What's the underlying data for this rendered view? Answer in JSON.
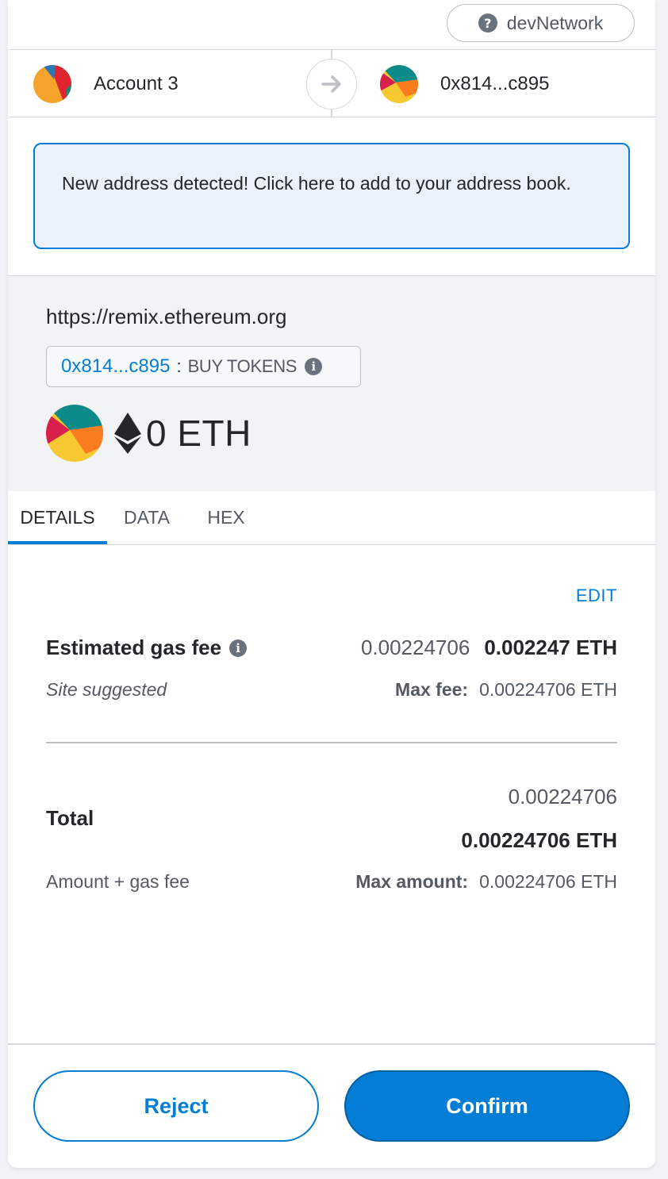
{
  "network": {
    "label": "devNetwork",
    "help_icon": "question-mark-icon"
  },
  "from_account": {
    "name": "Account 3",
    "avatar_colors": [
      "#f6a32b",
      "#e0242f",
      "#2f78b7"
    ]
  },
  "to_account": {
    "address": "0x814...c895",
    "avatar_colors": [
      "#f7c831",
      "#fa7c1e",
      "#0d8a8a",
      "#d7204c"
    ]
  },
  "banner": {
    "text": "New address detected! Click here to add to your address book."
  },
  "origin": {
    "url": "https://remix.ethereum.org",
    "method_address": "0x814...c895",
    "method_separator": ":",
    "method_name": "BUY TOKENS",
    "value": "0 ETH"
  },
  "tabs": [
    {
      "label": "DETAILS",
      "active": true
    },
    {
      "label": "DATA",
      "active": false
    },
    {
      "label": "HEX",
      "active": false
    }
  ],
  "details": {
    "edit_label": "EDIT",
    "gas_label": "Estimated gas fee",
    "gas_secondary": "0.00224706",
    "gas_primary": "0.002247 ETH",
    "site_suggested": "Site suggested",
    "max_fee_label": "Max fee:",
    "max_fee_value": "0.00224706 ETH",
    "total_label": "Total",
    "total_secondary": "0.00224706",
    "total_primary": "0.00224706 ETH",
    "amount_gas_label": "Amount + gas fee",
    "max_amount_label": "Max amount:",
    "max_amount_value": "0.00224706 ETH"
  },
  "buttons": {
    "reject": "Reject",
    "confirm": "Confirm"
  },
  "colors": {
    "primary": "#037dd6",
    "text": "#24272a",
    "muted": "#535a61",
    "banner_bg": "#eaf1fb"
  }
}
